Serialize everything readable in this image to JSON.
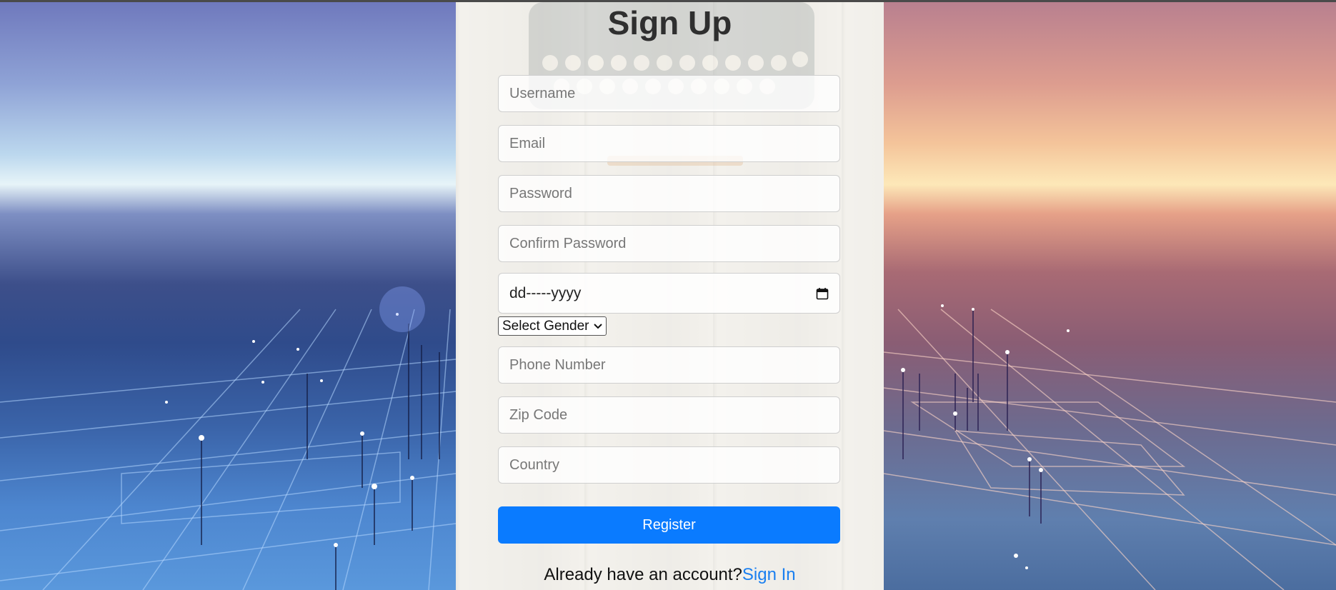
{
  "form": {
    "title": "Sign Up",
    "username_placeholder": "Username",
    "email_placeholder": "Email",
    "password_placeholder": "Password",
    "confirm_password_placeholder": "Confirm Password",
    "date_placeholder": "dd-----yyyy",
    "gender_select_label": "Select Gender",
    "phone_placeholder": "Phone Number",
    "zip_placeholder": "Zip Code",
    "country_placeholder": "Country",
    "register_label": "Register",
    "account_prompt": "Already have an account?",
    "signin_link": "Sign In"
  },
  "icons": {
    "calendar": "calendar-icon",
    "chevron": "chevron-down-icon"
  },
  "colors": {
    "accent": "#0a7bff",
    "link": "#1a7ff0",
    "title": "#2f2f2f",
    "panel": "#f3f1ec"
  }
}
